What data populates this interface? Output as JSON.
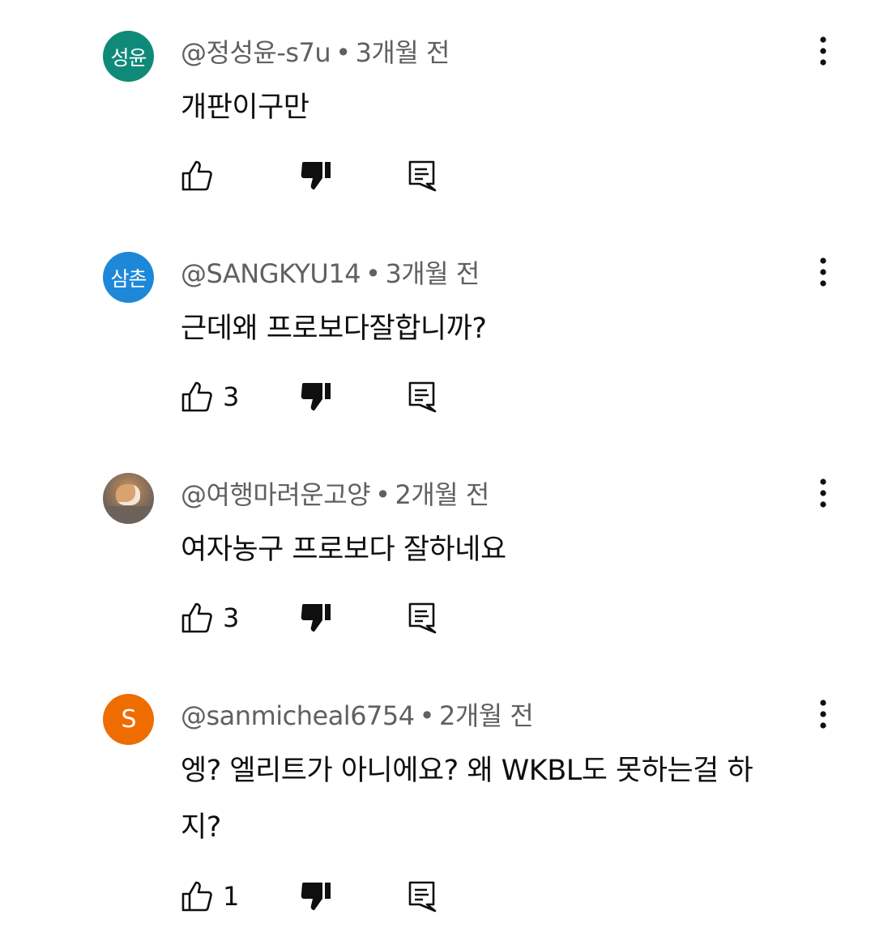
{
  "comments": [
    {
      "avatar_text": "성윤",
      "avatar_color": "#0f8a78",
      "author": "@정성윤-s7u",
      "time": "3개월 전",
      "text": "개판이구만",
      "likes": ""
    },
    {
      "avatar_text": "삼촌",
      "avatar_color": "#1e88d8",
      "author": "@SANGKYU14",
      "time": "3개월 전",
      "text": "근데왜 프로보다잘합니까?",
      "likes": "3"
    },
    {
      "avatar_text": "",
      "avatar_color": "",
      "author": "@여행마려운고양",
      "time": "2개월 전",
      "text": "여자농구 프로보다 잘하네요",
      "likes": "3"
    },
    {
      "avatar_text": "S",
      "avatar_color": "#ef6c00",
      "author": "@sanmicheal6754",
      "time": "2개월 전",
      "text": "엥? 엘리트가 아니에요? 왜 WKBL도 못하는걸 하지?",
      "likes": "1"
    }
  ],
  "separator": "•"
}
